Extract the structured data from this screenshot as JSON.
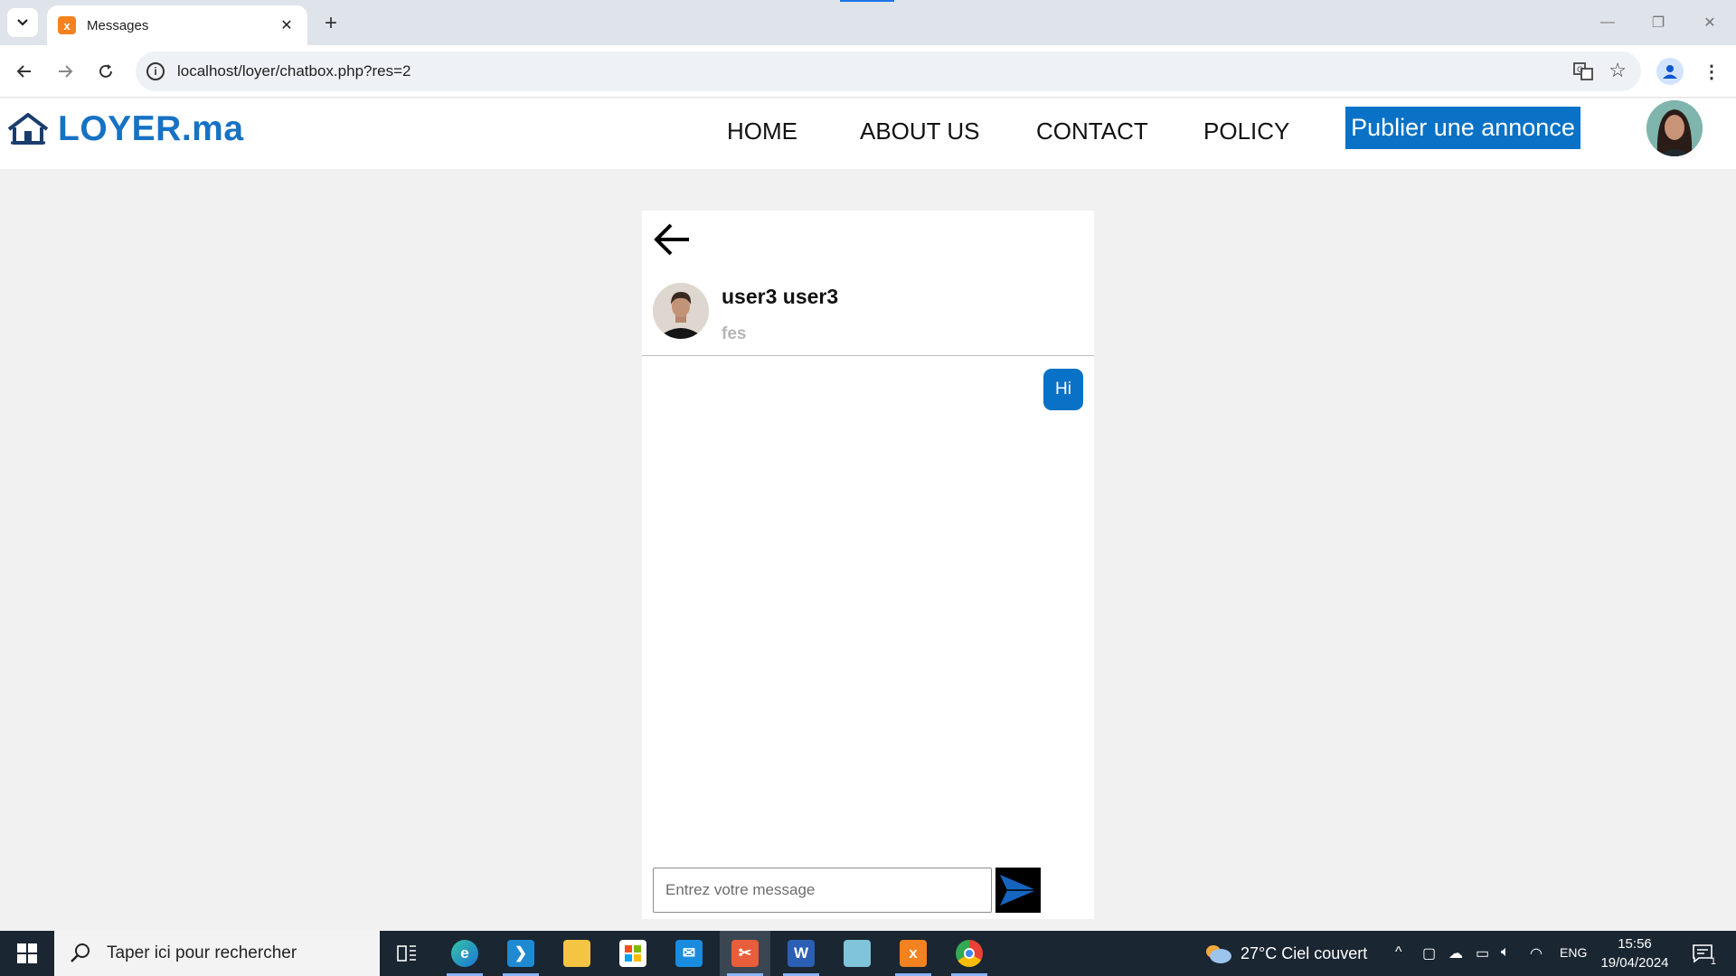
{
  "browser": {
    "tab_title": "Messages",
    "url": "localhost/loyer/chatbox.php?res=2"
  },
  "site": {
    "logo_text": "LOYER.ma",
    "nav": [
      "HOME",
      "ABOUT US",
      "CONTACT",
      "POLICY"
    ],
    "publish_button": "Publier une annonce"
  },
  "chat": {
    "user_name": "user3 user3",
    "user_city": "fes",
    "messages": [
      {
        "text": "Hi",
        "from": "me"
      }
    ],
    "input_placeholder": "Entrez votre message"
  },
  "taskbar": {
    "search_placeholder": "Taper ici pour rechercher",
    "weather": "27°C  Ciel couvert",
    "language": "ENG",
    "time": "15:56",
    "date": "19/04/2024",
    "notification_count": "1"
  },
  "colors": {
    "brand": "#1672c4",
    "button": "#0a72c6",
    "page_bg": "#f1f1f1"
  }
}
